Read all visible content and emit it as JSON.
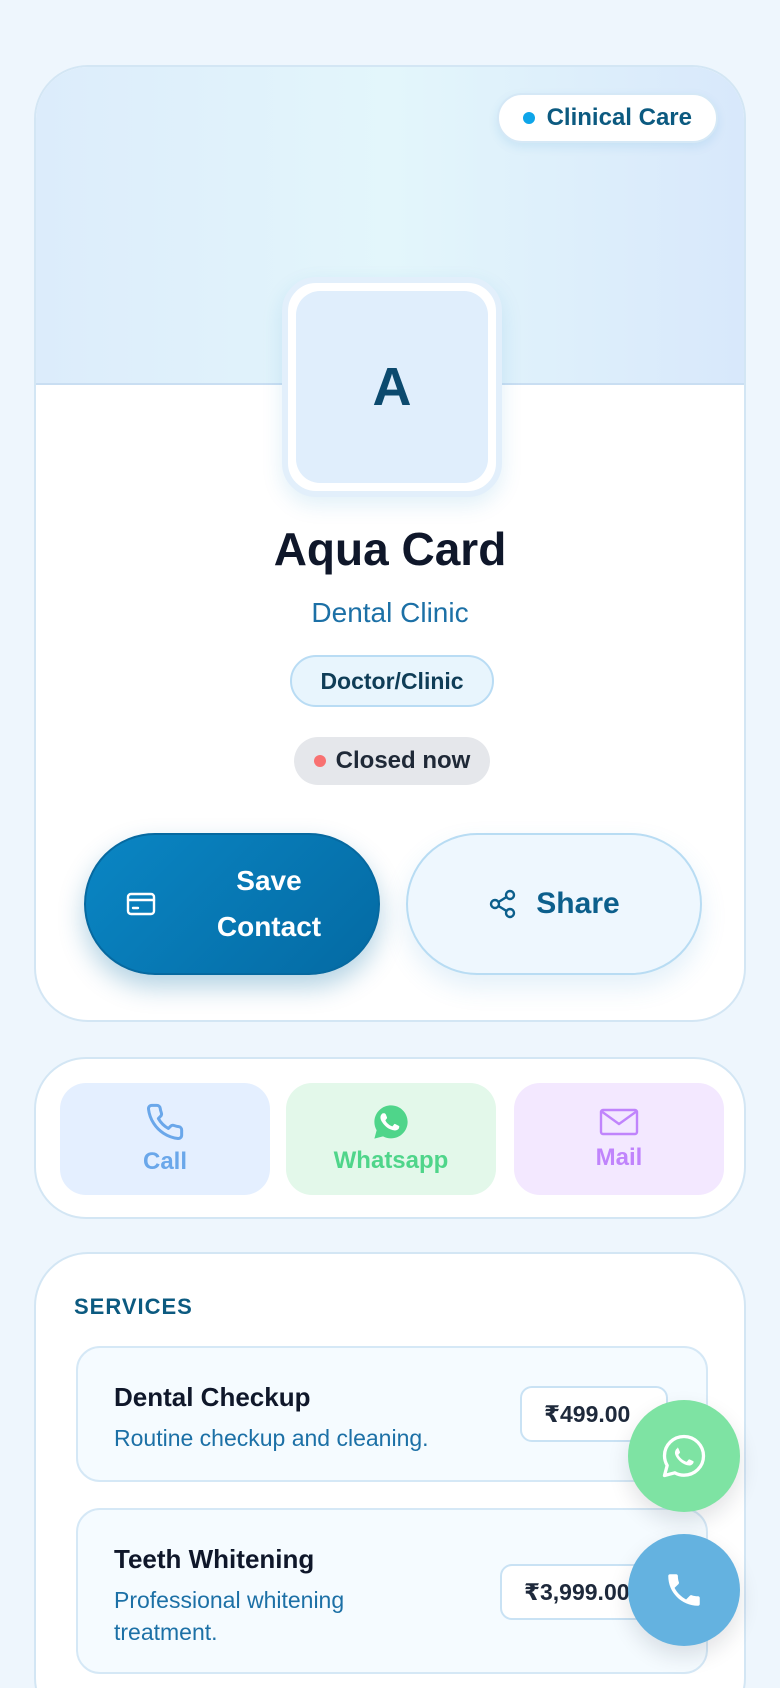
{
  "profile": {
    "category_badge": "Clinical Care",
    "avatar_initial": "A",
    "name": "Aqua Card",
    "subtitle": "Dental Clinic",
    "type": "Doctor/Clinic",
    "status": "Closed now",
    "save_label": "Save Contact",
    "share_label": "Share"
  },
  "actions": [
    {
      "label": "Call",
      "icon": "phone-icon"
    },
    {
      "label": "Whatsapp",
      "icon": "whatsapp-icon"
    },
    {
      "label": "Mail",
      "icon": "mail-icon"
    }
  ],
  "services": {
    "title": "SERVICES",
    "items": [
      {
        "name": "Dental Checkup",
        "description": "Routine checkup and cleaning.",
        "price": "₹499.00"
      },
      {
        "name": "Teeth Whitening",
        "description": "Professional whitening treatment.",
        "price": "₹3,999.00"
      }
    ]
  },
  "colors": {
    "accent": "#0284c7",
    "status_closed": "#f87171",
    "whatsapp": "#7ee3a3",
    "call_fab": "#64b2e0"
  }
}
